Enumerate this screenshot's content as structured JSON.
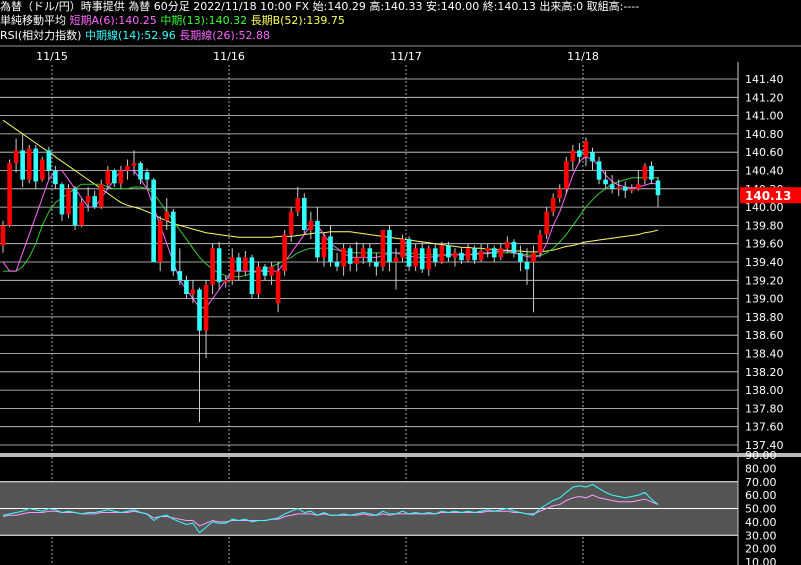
{
  "header": {
    "line1": "為替（ドル/円）時事提供 為替 60分足 2022/11/18 10:00 FX 始:140.29 高:140.33 安:140.00 終:140.13 出来高:0 取組高:----",
    "ma_title": "単純移動平均",
    "ma_short": "短期A(6):140.25",
    "ma_mid": "中期(13):140.32",
    "ma_long": "長期B(52):139.75",
    "rsi_title": "RSI(相対力指数)",
    "rsi_mid": "中期線(14):52.96",
    "rsi_long": "長期線(26):52.88"
  },
  "colors": {
    "up": "#ff0000",
    "down": "#33ffff",
    "ma_short": "#ff66ff",
    "ma_mid": "#33cc33",
    "ma_long": "#ffff66",
    "rsi_mid": "#33ffff",
    "rsi_long": "#ff99ff",
    "price_tag_bg": "#ff0000",
    "grid": "#ffffff",
    "background": "#000000"
  },
  "chart_data": {
    "type": "candlestick",
    "x_labels": [
      {
        "label": "11/15",
        "bar": 4
      },
      {
        "label": "11/16",
        "bar": 34
      },
      {
        "label": "11/17",
        "bar": 66
      },
      {
        "label": "11/18",
        "bar": 95
      }
    ],
    "price_axis": {
      "ylim": [
        137.4,
        141.4
      ],
      "ticks": [
        "141.40",
        "141.20",
        "141.00",
        "140.80",
        "140.60",
        "140.40",
        "140.20",
        "140.00",
        "139.80",
        "139.60",
        "139.40",
        "139.20",
        "139.00",
        "138.80",
        "138.60",
        "138.40",
        "138.20",
        "138.00",
        "137.80",
        "137.60",
        "137.40"
      ]
    },
    "last_price": "140.13",
    "candles": [
      [
        139.58,
        139.85,
        139.5,
        139.8
      ],
      [
        139.8,
        140.52,
        139.78,
        140.48
      ],
      [
        140.48,
        140.75,
        140.38,
        140.62
      ],
      [
        140.62,
        140.8,
        140.22,
        140.3
      ],
      [
        140.3,
        140.68,
        140.26,
        140.64
      ],
      [
        140.64,
        140.68,
        140.2,
        140.28
      ],
      [
        140.3,
        140.55,
        140.28,
        140.52
      ],
      [
        140.62,
        140.66,
        140.3,
        140.4
      ],
      [
        140.4,
        140.45,
        140.2,
        140.25
      ],
      [
        140.25,
        140.27,
        139.85,
        139.92
      ],
      [
        139.92,
        140.25,
        139.88,
        140.2
      ],
      [
        140.2,
        140.23,
        139.75,
        139.8
      ],
      [
        139.8,
        140.1,
        139.78,
        140.05
      ],
      [
        140.05,
        140.22,
        139.95,
        140.12
      ],
      [
        140.12,
        140.18,
        139.98,
        140.0
      ],
      [
        140.0,
        140.3,
        139.98,
        140.25
      ],
      [
        140.25,
        140.45,
        140.2,
        140.4
      ],
      [
        140.4,
        140.42,
        140.22,
        140.26
      ],
      [
        140.26,
        140.45,
        140.2,
        140.4
      ],
      [
        140.4,
        140.52,
        140.3,
        140.45
      ],
      [
        140.45,
        140.62,
        140.35,
        140.48
      ],
      [
        140.48,
        140.5,
        140.25,
        140.3
      ],
      [
        140.38,
        140.42,
        140.2,
        140.3
      ],
      [
        140.3,
        140.32,
        139.55,
        139.4
      ],
      [
        139.4,
        139.9,
        139.3,
        139.85
      ],
      [
        139.85,
        140.1,
        139.75,
        139.95
      ],
      [
        139.95,
        139.98,
        139.25,
        139.3
      ],
      [
        139.3,
        139.55,
        139.15,
        139.2
      ],
      [
        139.2,
        139.25,
        139.0,
        139.05
      ],
      [
        139.05,
        139.2,
        138.95,
        139.1
      ],
      [
        139.1,
        139.12,
        137.65,
        138.65
      ],
      [
        138.65,
        139.2,
        138.35,
        139.15
      ],
      [
        139.15,
        139.6,
        139.05,
        139.55
      ],
      [
        139.55,
        139.62,
        139.1,
        139.18
      ],
      [
        139.18,
        139.25,
        139.12,
        139.2
      ],
      [
        139.2,
        139.55,
        139.15,
        139.45
      ],
      [
        139.45,
        139.5,
        139.2,
        139.3
      ],
      [
        139.3,
        139.52,
        139.25,
        139.45
      ],
      [
        139.45,
        139.48,
        139.0,
        139.05
      ],
      [
        139.05,
        139.4,
        139.0,
        139.35
      ],
      [
        139.35,
        139.38,
        139.2,
        139.25
      ],
      [
        139.25,
        139.4,
        139.15,
        139.35
      ],
      [
        138.95,
        139.4,
        138.85,
        139.3
      ],
      [
        139.3,
        139.75,
        139.25,
        139.7
      ],
      [
        139.7,
        140.0,
        139.62,
        139.95
      ],
      [
        139.95,
        140.22,
        139.9,
        140.1
      ],
      [
        140.1,
        140.15,
        139.7,
        139.75
      ],
      [
        139.75,
        139.95,
        139.65,
        139.85
      ],
      [
        139.85,
        140.0,
        139.4,
        139.45
      ],
      [
        139.45,
        139.72,
        139.35,
        139.68
      ],
      [
        139.68,
        139.8,
        139.35,
        139.4
      ],
      [
        139.4,
        139.5,
        139.3,
        139.35
      ],
      [
        139.35,
        139.6,
        139.25,
        139.55
      ],
      [
        139.55,
        139.58,
        139.3,
        139.38
      ],
      [
        139.38,
        139.62,
        139.3,
        139.45
      ],
      [
        139.45,
        139.6,
        139.38,
        139.55
      ],
      [
        139.55,
        139.6,
        139.35,
        139.4
      ],
      [
        139.4,
        139.5,
        139.25,
        139.35
      ],
      [
        139.35,
        139.7,
        139.3,
        139.75
      ],
      [
        139.75,
        139.8,
        139.3,
        139.4
      ],
      [
        139.4,
        139.55,
        139.1,
        139.45
      ],
      [
        139.45,
        139.7,
        139.4,
        139.65
      ],
      [
        139.65,
        139.68,
        139.3,
        139.35
      ],
      [
        139.35,
        139.6,
        139.3,
        139.55
      ],
      [
        139.55,
        139.62,
        139.28,
        139.32
      ],
      [
        139.32,
        139.58,
        139.25,
        139.55
      ],
      [
        139.55,
        139.6,
        139.35,
        139.4
      ],
      [
        139.4,
        139.62,
        139.38,
        139.58
      ],
      [
        139.58,
        139.62,
        139.4,
        139.45
      ],
      [
        139.45,
        139.55,
        139.35,
        139.5
      ],
      [
        139.5,
        139.55,
        139.38,
        139.42
      ],
      [
        139.42,
        139.6,
        139.4,
        139.55
      ],
      [
        139.55,
        139.58,
        139.38,
        139.42
      ],
      [
        139.42,
        139.6,
        139.4,
        139.52
      ],
      [
        139.52,
        139.6,
        139.45,
        139.55
      ],
      [
        139.55,
        139.58,
        139.4,
        139.45
      ],
      [
        139.45,
        139.6,
        139.42,
        139.55
      ],
      [
        139.55,
        139.68,
        139.5,
        139.62
      ],
      [
        139.62,
        139.65,
        139.45,
        139.5
      ],
      [
        139.5,
        139.58,
        139.3,
        139.4
      ],
      [
        139.4,
        139.55,
        139.15,
        139.32
      ],
      [
        139.4,
        139.58,
        138.85,
        139.5
      ],
      [
        139.5,
        139.75,
        139.45,
        139.7
      ],
      [
        139.7,
        140.0,
        139.65,
        139.95
      ],
      [
        139.95,
        140.15,
        139.9,
        140.1
      ],
      [
        140.1,
        140.25,
        140.05,
        140.2
      ],
      [
        140.2,
        140.55,
        140.15,
        140.5
      ],
      [
        140.5,
        140.68,
        140.4,
        140.62
      ],
      [
        140.62,
        140.7,
        140.48,
        140.55
      ],
      [
        140.55,
        140.76,
        140.45,
        140.72
      ],
      [
        140.6,
        140.65,
        140.4,
        140.5
      ],
      [
        140.5,
        140.55,
        140.25,
        140.3
      ],
      [
        140.3,
        140.4,
        140.2,
        140.25
      ],
      [
        140.25,
        140.35,
        140.15,
        140.2
      ],
      [
        140.2,
        140.3,
        140.12,
        140.22
      ],
      [
        140.22,
        140.28,
        140.1,
        140.18
      ],
      [
        140.18,
        140.25,
        140.15,
        140.2
      ],
      [
        140.2,
        140.4,
        140.18,
        140.25
      ],
      [
        140.3,
        140.48,
        140.25,
        140.45
      ],
      [
        140.45,
        140.5,
        140.25,
        140.3
      ],
      [
        140.29,
        140.33,
        140.0,
        140.13
      ]
    ],
    "ma_short": [
      139.4,
      139.3,
      139.3,
      139.5,
      139.7,
      139.9,
      140.1,
      140.3,
      140.4,
      140.4,
      140.3,
      140.2,
      140.1,
      140.0,
      140.0,
      140.1,
      140.2,
      140.3,
      140.4,
      140.4,
      140.4,
      140.3,
      140.2,
      140.0,
      139.8,
      139.6,
      139.4,
      139.2,
      139.1,
      139.0,
      138.9,
      138.9,
      139.0,
      139.1,
      139.2,
      139.3,
      139.3,
      139.3,
      139.3,
      139.3,
      139.3,
      139.3,
      139.3,
      139.4,
      139.5,
      139.6,
      139.7,
      139.8,
      139.8,
      139.7,
      139.6,
      139.55,
      139.5,
      139.45,
      139.45,
      139.45,
      139.45,
      139.45,
      139.47,
      139.5,
      139.5,
      139.48,
      139.47,
      139.45,
      139.45,
      139.45,
      139.46,
      139.47,
      139.48,
      139.48,
      139.48,
      139.48,
      139.49,
      139.5,
      139.5,
      139.51,
      139.52,
      139.52,
      139.5,
      139.48,
      139.46,
      139.45,
      139.47,
      139.6,
      139.8,
      139.95,
      140.15,
      140.35,
      140.5,
      140.55,
      140.52,
      140.45,
      140.35,
      140.28,
      140.24,
      140.22,
      140.21,
      140.22,
      140.24,
      140.26,
      140.25
    ],
    "ma_mid": [
      139.3,
      139.3,
      139.3,
      139.35,
      139.45,
      139.6,
      139.8,
      139.95,
      140.05,
      140.1,
      140.15,
      140.2,
      140.25,
      140.25,
      140.25,
      140.25,
      140.22,
      140.2,
      140.2,
      140.2,
      140.22,
      140.22,
      140.2,
      140.15,
      140.05,
      139.95,
      139.85,
      139.75,
      139.65,
      139.55,
      139.45,
      139.38,
      139.32,
      139.28,
      139.25,
      139.24,
      139.24,
      139.25,
      139.28,
      139.3,
      139.32,
      139.35,
      139.38,
      139.42,
      139.45,
      139.5,
      139.53,
      139.55,
      139.55,
      139.55,
      139.55,
      139.53,
      139.52,
      139.5,
      139.5,
      139.5,
      139.5,
      139.5,
      139.5,
      139.5,
      139.5,
      139.5,
      139.5,
      139.49,
      139.48,
      139.48,
      139.48,
      139.48,
      139.48,
      139.48,
      139.48,
      139.48,
      139.48,
      139.49,
      139.49,
      139.5,
      139.5,
      139.5,
      139.5,
      139.49,
      139.48,
      139.47,
      139.47,
      139.5,
      139.55,
      139.62,
      139.7,
      139.8,
      139.9,
      140.0,
      140.08,
      140.15,
      140.2,
      140.25,
      140.28,
      140.3,
      140.32,
      140.32,
      140.32,
      140.32,
      140.32
    ],
    "ma_long": [
      140.95,
      140.9,
      140.85,
      140.8,
      140.75,
      140.7,
      140.65,
      140.6,
      140.55,
      140.5,
      140.45,
      140.4,
      140.35,
      140.3,
      140.25,
      140.2,
      140.15,
      140.1,
      140.05,
      140.02,
      140.0,
      139.98,
      139.95,
      139.92,
      139.88,
      139.85,
      139.82,
      139.8,
      139.78,
      139.76,
      139.74,
      139.72,
      139.71,
      139.7,
      139.69,
      139.68,
      139.67,
      139.67,
      139.67,
      139.67,
      139.67,
      139.67,
      139.68,
      139.68,
      139.68,
      139.69,
      139.7,
      139.71,
      139.72,
      139.72,
      139.73,
      139.73,
      139.73,
      139.73,
      139.72,
      139.71,
      139.7,
      139.69,
      139.68,
      139.67,
      139.66,
      139.65,
      139.64,
      139.63,
      139.62,
      139.61,
      139.6,
      139.59,
      139.58,
      139.57,
      139.56,
      139.56,
      139.55,
      139.55,
      139.54,
      139.54,
      139.53,
      139.53,
      139.52,
      139.52,
      139.51,
      139.51,
      139.51,
      139.52,
      139.53,
      139.55,
      139.57,
      139.58,
      139.6,
      139.62,
      139.63,
      139.64,
      139.65,
      139.66,
      139.67,
      139.68,
      139.69,
      139.7,
      139.72,
      139.73,
      139.75
    ],
    "rsi_axis": {
      "ylim": [
        10,
        90
      ],
      "ticks": [
        "90.00",
        "80.00",
        "70.00",
        "60.00",
        "50.00",
        "40.00",
        "30.00",
        "20.00",
        "10.00"
      ],
      "bands": [
        30,
        50,
        70
      ]
    },
    "rsi_mid": [
      45,
      46,
      47,
      48,
      50,
      49,
      48,
      50,
      49,
      47,
      48,
      47,
      46,
      47,
      47,
      48,
      49,
      48,
      47,
      48,
      49,
      47,
      46,
      41,
      44,
      45,
      42,
      40,
      38,
      39,
      32,
      36,
      40,
      39,
      39,
      42,
      41,
      42,
      40,
      41,
      41,
      42,
      43,
      46,
      48,
      50,
      47,
      48,
      45,
      47,
      45,
      45,
      46,
      45,
      46,
      47,
      46,
      45,
      48,
      46,
      46,
      48,
      46,
      47,
      46,
      47,
      46,
      48,
      47,
      48,
      47,
      48,
      47,
      48,
      49,
      48,
      49,
      50,
      48,
      47,
      46,
      45,
      50,
      53,
      56,
      58,
      62,
      66,
      67,
      66,
      68,
      65,
      62,
      60,
      59,
      58,
      59,
      60,
      62,
      57,
      53
    ],
    "rsi_long": [
      44,
      45,
      45,
      46,
      47,
      47,
      47,
      48,
      48,
      47,
      47,
      47,
      46,
      46,
      46,
      47,
      47,
      47,
      47,
      47,
      48,
      47,
      46,
      43,
      44,
      44,
      43,
      42,
      41,
      41,
      37,
      39,
      41,
      40,
      40,
      41,
      41,
      41,
      41,
      41,
      41,
      42,
      42,
      44,
      45,
      46,
      46,
      46,
      45,
      46,
      45,
      45,
      45,
      45,
      45,
      46,
      45,
      45,
      46,
      45,
      46,
      46,
      46,
      46,
      46,
      46,
      46,
      47,
      47,
      47,
      47,
      47,
      47,
      47,
      48,
      48,
      48,
      48,
      47,
      47,
      46,
      46,
      48,
      50,
      52,
      53,
      56,
      58,
      59,
      58,
      60,
      58,
      57,
      56,
      55,
      55,
      55,
      56,
      57,
      55,
      53
    ]
  }
}
